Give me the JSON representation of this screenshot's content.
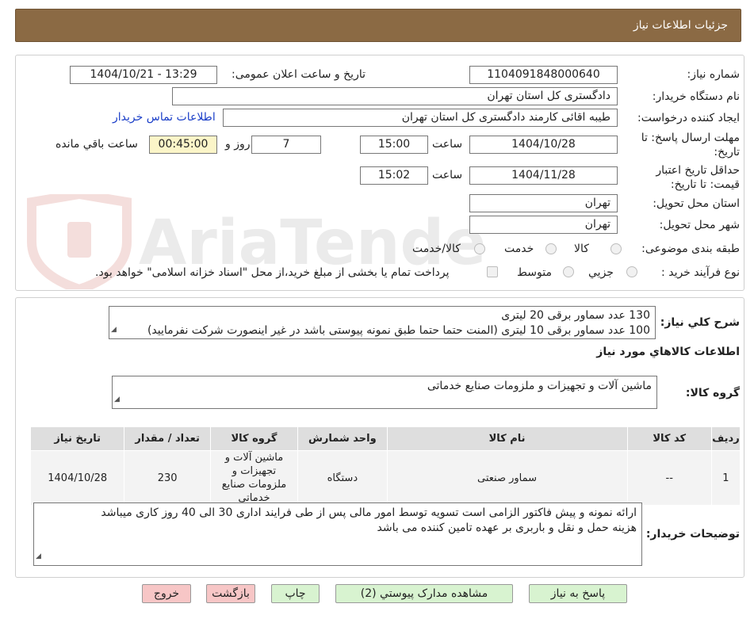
{
  "header": {
    "title": "جزئیات اطلاعات نیاز"
  },
  "form": {
    "need_number_label": "شماره نیاز:",
    "need_number": "1104091848000640",
    "announce_label": "تاریخ و ساعت اعلان عمومی:",
    "announce_value": "1404/10/21 - 13:29",
    "buyer_org_label": "نام دستگاه خریدار:",
    "buyer_org": "دادگستری کل استان تهران",
    "creator_label": "ایجاد کننده درخواست:",
    "creator": "طیبه اقائی کارمند دادگستری کل استان تهران",
    "contact_link": "اطلاعات تماس خریدار",
    "deadline_label": "مهلت ارسال پاسخ: تا تاریخ:",
    "deadline_date": "1404/10/28",
    "time_label": "ساعت",
    "deadline_time": "15:00",
    "days_value": "7",
    "days_label": "روز و",
    "remaining_time": "00:45:00",
    "remaining_label": "ساعت باقي مانده",
    "validity_label": "حداقل تاریخ اعتبار قیمت: تا تاریخ:",
    "validity_date": "1404/11/28",
    "validity_time": "15:02",
    "province_label": "استان محل تحویل:",
    "province": "تهران",
    "city_label": "شهر محل تحویل:",
    "city": "تهران",
    "category_label": "طبقه بندی موضوعی:",
    "category_options": [
      "کالا",
      "خدمت",
      "کالا/خدمت"
    ],
    "process_label": "نوع فرآیند خرید :",
    "process_options": [
      "جزیي",
      "متوسط"
    ],
    "payment_note": "پرداخت تمام یا بخشی از مبلغ خرید،از محل \"اسناد خزانه اسلامی\" خواهد بود."
  },
  "description": {
    "label": "شرح کلي نياز:",
    "line1": "130 عدد سماور برقی 20 لیتری",
    "line2": "100 عدد سماور برقی 10 لیتری (المنت حتما حتما طبق نمونه پیوستی باشد در غیر اینصورت شرکت نفرمایید)"
  },
  "goods_info_title": "اطلاعات کالاهاي مورد نياز",
  "goods_group": {
    "label": "گروه کالا:",
    "value": "ماشین آلات و تجهیزات و ملزومات صنایع خدماتی"
  },
  "table": {
    "headers": [
      "ردیف",
      "کد کالا",
      "نام کالا",
      "واحد شمارش",
      "گروه کالا",
      "تعداد / مقدار",
      "تاریخ نیاز"
    ],
    "rows": [
      [
        "1",
        "--",
        "سماور صنعتی",
        "دستگاه",
        "ماشین آلات و تجهیزات و ملزومات صنایع خدماتی",
        "230",
        "1404/10/28"
      ]
    ]
  },
  "buyer_notes": {
    "label": "توضیحات خریدار:",
    "line1": "ارائه نمونه و پیش فاکتور الزامی است تسویه توسط امور مالی پس از طی فرایند اداری 30 الی 40 روز کاری میباشد",
    "line2": "هزینه حمل و نقل و باربری بر عهده تامین کننده می باشد"
  },
  "buttons": {
    "reply": "پاسخ به نیاز",
    "attachments": "مشاهده مدارک پیوستي (2)",
    "print": "چاپ",
    "back": "بازگشت",
    "exit": "خروج"
  },
  "watermark_text": "AriaTender.neT",
  "colors": {
    "header_bg": "#8b6a44",
    "green_button": "#d8f3d0",
    "pink_button": "#f7c6c6",
    "remaining_bg": "#fbf5c8",
    "link": "#1a3ec8"
  }
}
